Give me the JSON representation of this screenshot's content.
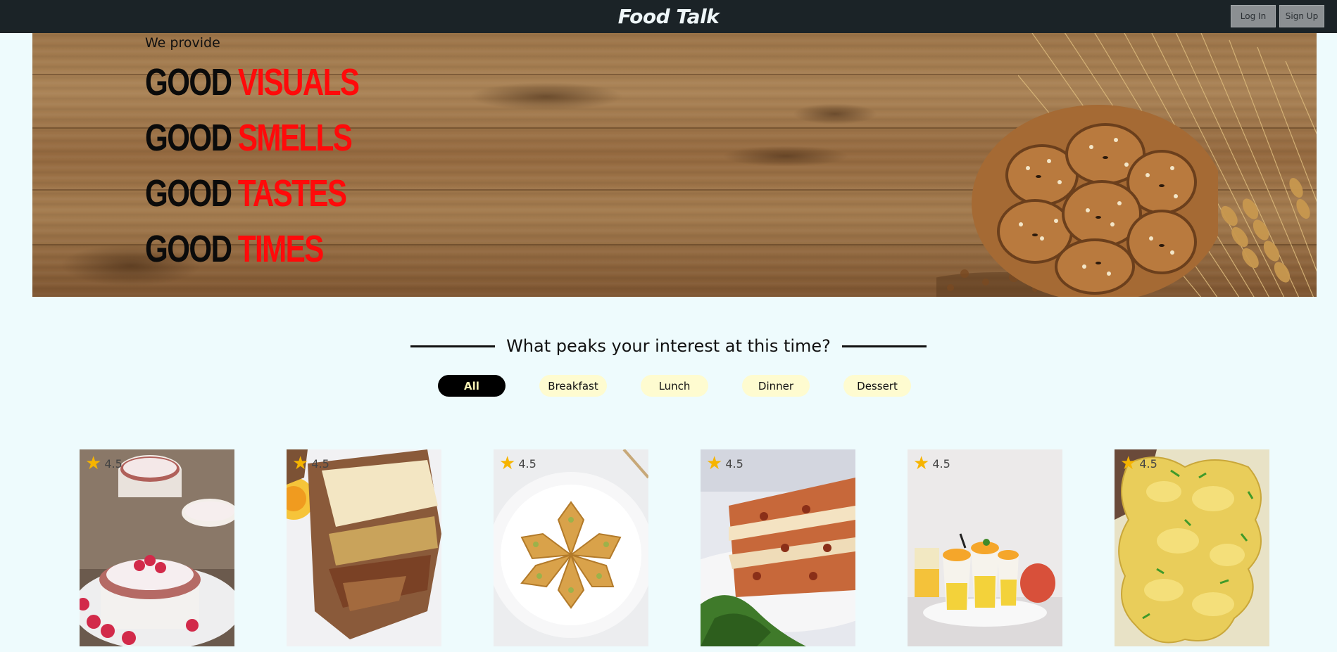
{
  "header": {
    "brand": "Food Talk",
    "login_label": "Log In",
    "signup_label": "Sign Up"
  },
  "hero": {
    "intro": "We provide",
    "lines": [
      {
        "lead": "GOOD",
        "accent": "VISUALS"
      },
      {
        "lead": "GOOD",
        "accent": "SMELLS"
      },
      {
        "lead": "GOOD",
        "accent": "TASTES"
      },
      {
        "lead": "GOOD",
        "accent": "TIMES"
      }
    ]
  },
  "section": {
    "title": "What peaks your interest at this time?"
  },
  "filters": [
    {
      "label": "All",
      "active": true
    },
    {
      "label": "Breakfast",
      "active": false
    },
    {
      "label": "Lunch",
      "active": false
    },
    {
      "label": "Dinner",
      "active": false
    },
    {
      "label": "Dessert",
      "active": false
    }
  ],
  "cards": [
    {
      "rating": "4.5",
      "icon": "souffle-photo"
    },
    {
      "rating": "4.5",
      "icon": "lasagna-slice-photo"
    },
    {
      "rating": "4.5",
      "icon": "baklava-photo"
    },
    {
      "rating": "4.5",
      "icon": "lasagna-plate-photo"
    },
    {
      "rating": "4.5",
      "icon": "mango-pudding-photo"
    },
    {
      "rating": "4.5",
      "icon": "scrambled-eggs-photo"
    }
  ],
  "colors": {
    "topbar": "#1b2327",
    "page": "#eefbfd",
    "accent_red": "#ff0a0a",
    "pill": "#fefbd0",
    "star": "#f6b400"
  }
}
